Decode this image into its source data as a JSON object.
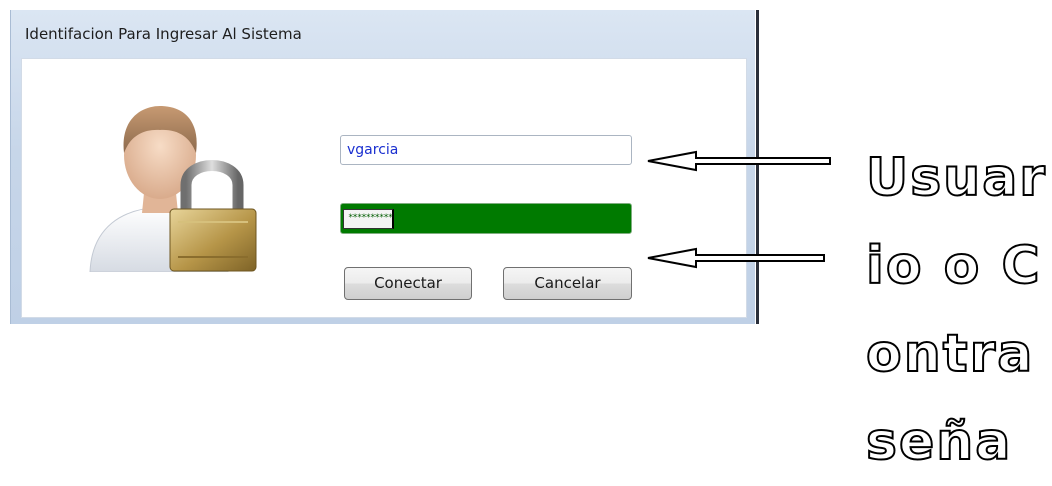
{
  "window": {
    "title": "Identifacion Para Ingresar Al Sistema"
  },
  "login": {
    "username_value": "vgarcia",
    "password_mask": "**********",
    "connect_label": "Conectar",
    "cancel_label": "Cancelar"
  },
  "icons": {
    "user": "user-lock-icon"
  },
  "annotation": {
    "text": "Usuario o Contraseña"
  },
  "colors": {
    "password_bg": "#007a00",
    "username_text": "#1a2fd0"
  }
}
